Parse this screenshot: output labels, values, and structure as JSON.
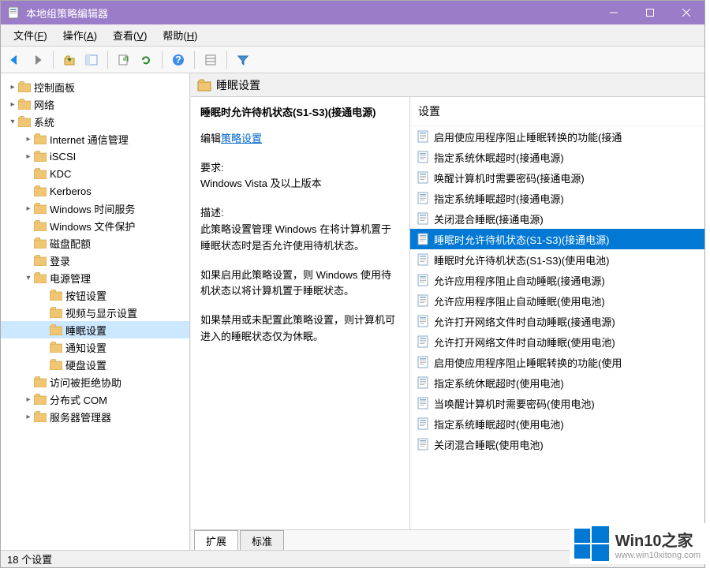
{
  "title": "本地组策略编辑器",
  "menus": [
    {
      "label": "文件",
      "key": "F"
    },
    {
      "label": "操作",
      "key": "A"
    },
    {
      "label": "查看",
      "key": "V"
    },
    {
      "label": "帮助",
      "key": "H"
    }
  ],
  "tree": [
    {
      "label": "控制面板",
      "depth": 0,
      "caret": ">"
    },
    {
      "label": "网络",
      "depth": 0,
      "caret": ">"
    },
    {
      "label": "系统",
      "depth": 0,
      "caret": "v",
      "open": true
    },
    {
      "label": "Internet 通信管理",
      "depth": 1,
      "caret": ">"
    },
    {
      "label": "iSCSI",
      "depth": 1,
      "caret": ">"
    },
    {
      "label": "KDC",
      "depth": 1,
      "caret": ""
    },
    {
      "label": "Kerberos",
      "depth": 1,
      "caret": ""
    },
    {
      "label": "Windows 时间服务",
      "depth": 1,
      "caret": ">"
    },
    {
      "label": "Windows 文件保护",
      "depth": 1,
      "caret": ""
    },
    {
      "label": "磁盘配额",
      "depth": 1,
      "caret": ""
    },
    {
      "label": "登录",
      "depth": 1,
      "caret": ""
    },
    {
      "label": "电源管理",
      "depth": 1,
      "caret": "v",
      "open": true
    },
    {
      "label": "按钮设置",
      "depth": 2,
      "caret": ""
    },
    {
      "label": "视频与显示设置",
      "depth": 2,
      "caret": ""
    },
    {
      "label": "睡眠设置",
      "depth": 2,
      "caret": "",
      "selected": true
    },
    {
      "label": "通知设置",
      "depth": 2,
      "caret": ""
    },
    {
      "label": "硬盘设置",
      "depth": 2,
      "caret": ""
    },
    {
      "label": "访问被拒绝协助",
      "depth": 1,
      "caret": ""
    },
    {
      "label": "分布式 COM",
      "depth": 1,
      "caret": ">"
    },
    {
      "label": "服务器管理器",
      "depth": 1,
      "caret": ">"
    }
  ],
  "crumb_label": "睡眠设置",
  "detail": {
    "title": "睡眠时允许待机状态(S1-S3)(接通电源)",
    "edit_label": "编辑",
    "link_text": "策略设置",
    "req_label": "要求:",
    "req_value": "Windows Vista 及以上版本",
    "desc_label": "描述:",
    "desc1": "此策略设置管理 Windows 在将计算机置于睡眠状态时是否允许使用待机状态。",
    "desc2": "如果启用此策略设置，则 Windows 使用待机状态以将计算机置于睡眠状态。",
    "desc3": "如果禁用或未配置此策略设置，则计算机可进入的睡眠状态仅为休眠。"
  },
  "list_header": "设置",
  "settings": [
    {
      "label": "启用使应用程序阻止睡眠转换的功能(接通"
    },
    {
      "label": "指定系统休眠超时(接通电源)"
    },
    {
      "label": "唤醒计算机时需要密码(接通电源)"
    },
    {
      "label": "指定系统睡眠超时(接通电源)"
    },
    {
      "label": "关闭混合睡眠(接通电源)"
    },
    {
      "label": "睡眠时允许待机状态(S1-S3)(接通电源)",
      "selected": true
    },
    {
      "label": "睡眠时允许待机状态(S1-S3)(使用电池)"
    },
    {
      "label": "允许应用程序阻止自动睡眠(接通电源)"
    },
    {
      "label": "允许应用程序阻止自动睡眠(使用电池)"
    },
    {
      "label": "允许打开网络文件时自动睡眠(接通电源)"
    },
    {
      "label": "允许打开网络文件时自动睡眠(使用电池)"
    },
    {
      "label": "启用使应用程序阻止睡眠转换的功能(使用"
    },
    {
      "label": "指定系统休眠超时(使用电池)"
    },
    {
      "label": "当唤醒计算机时需要密码(使用电池)"
    },
    {
      "label": "指定系统睡眠超时(使用电池)"
    },
    {
      "label": "关闭混合睡眠(使用电池)"
    }
  ],
  "tabs": [
    {
      "label": "扩展",
      "active": true
    },
    {
      "label": "标准",
      "active": false
    }
  ],
  "status": "18 个设置",
  "watermark": {
    "text": "Win10之家",
    "url": "www.win10xitong.com"
  }
}
